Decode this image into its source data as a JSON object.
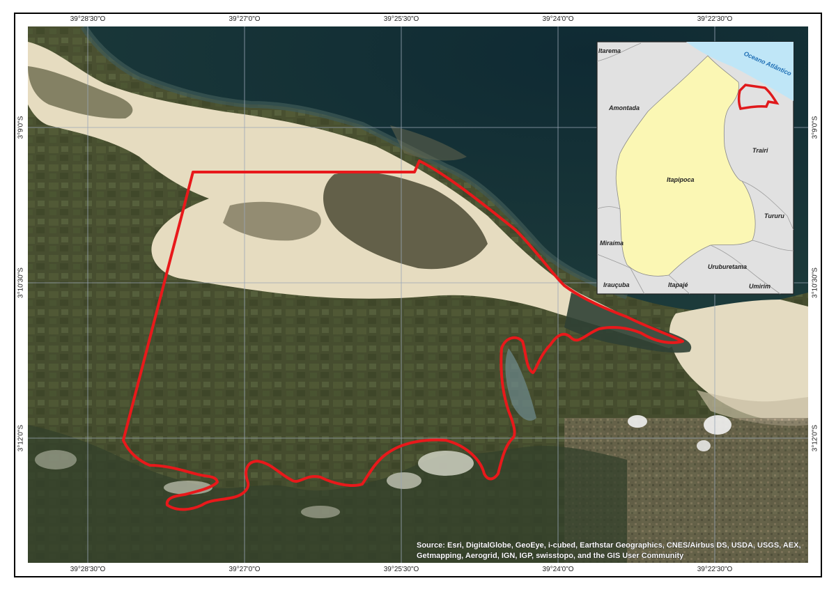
{
  "coords": {
    "top": [
      "39°28'30\"O",
      "39°27'0\"O",
      "39°25'30\"O",
      "39°24'0\"O",
      "39°22'30\"O"
    ],
    "bottom": [
      "39°28'30\"O",
      "39°27'0\"O",
      "39°25'30\"O",
      "39°24'0\"O",
      "39°22'30\"O"
    ],
    "left": [
      "3°9'0\"S",
      "3°10'30\"S",
      "3°12'0\"S"
    ],
    "right": [
      "3°9'0\"S",
      "3°10'30\"S",
      "3°12'0\"S"
    ]
  },
  "inset": {
    "ocean_label": "Oceano Atlântico",
    "municipalities": {
      "itarema": "Itarema",
      "amontada": "Amontada",
      "trairi": "Trairi",
      "itapipoca": "Itapipoca",
      "tururu": "Tururu",
      "miraima": "Miraíma",
      "uruburetama": "Uruburetama",
      "iraucuba": "Irauçuba",
      "itapaje": "Itapajé",
      "umirim": "Umirim"
    },
    "colors": {
      "ocean": "#bfe6f7",
      "study_municipality": "#fbf7b4",
      "neighbors": "#e1e1e1",
      "boundary": "#e0191b"
    }
  },
  "attribution": {
    "line1": "Source: Esri, DigitalGlobe, GeoEye, i-cubed, Earthstar Geographics, CNES/Airbus DS, USDA, USGS, AEX,",
    "line2": "Getmapping, Aerogrid, IGN, IGP, swisstopo, and the GIS User Community"
  },
  "colors": {
    "study_area_outline": "#e8191b",
    "grid": "#9aa6b6"
  }
}
